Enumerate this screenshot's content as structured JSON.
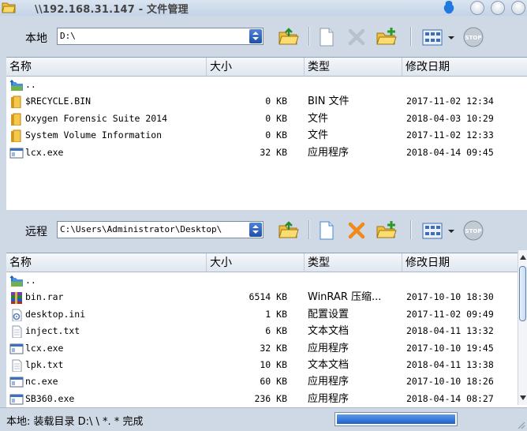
{
  "window": {
    "title": "\\\\192.168.31.147 - 文件管理"
  },
  "local": {
    "label": "本地",
    "path": "D:\\",
    "columns": [
      "名称",
      "大小",
      "类型",
      "修改日期"
    ],
    "rows": [
      {
        "icon": "parent-dir-icon",
        "name": "..",
        "size": "",
        "type": "",
        "date": ""
      },
      {
        "icon": "folder-icon",
        "name": "$RECYCLE.BIN",
        "size": "0 KB",
        "type": "BIN 文件",
        "date": "2017-11-02 12:34"
      },
      {
        "icon": "folder-icon",
        "name": "Oxygen Forensic Suite 2014",
        "size": "0 KB",
        "type": "文件",
        "date": "2018-04-03 10:29"
      },
      {
        "icon": "folder-icon",
        "name": "System Volume Information",
        "size": "0 KB",
        "type": "文件",
        "date": "2017-11-02 12:33"
      },
      {
        "icon": "exe-icon",
        "name": "lcx.exe",
        "size": "32 KB",
        "type": "应用程序",
        "date": "2018-04-14 09:45"
      }
    ]
  },
  "remote": {
    "label": "远程",
    "path": "C:\\Users\\Administrator\\Desktop\\",
    "columns": [
      "名称",
      "大小",
      "类型",
      "修改日期"
    ],
    "rows": [
      {
        "icon": "parent-dir-icon",
        "name": "..",
        "size": "",
        "type": "",
        "date": ""
      },
      {
        "icon": "rar-icon",
        "name": "bin.rar",
        "size": "6514 KB",
        "type": "WinRAR 压缩...",
        "date": "2017-10-10 18:30"
      },
      {
        "icon": "ini-icon",
        "name": "desktop.ini",
        "size": "1 KB",
        "type": "配置设置",
        "date": "2017-11-02 09:49"
      },
      {
        "icon": "txt-icon",
        "name": "inject.txt",
        "size": "6 KB",
        "type": "文本文档",
        "date": "2018-04-11 13:32"
      },
      {
        "icon": "exe-icon",
        "name": "lcx.exe",
        "size": "32 KB",
        "type": "应用程序",
        "date": "2017-10-10 19:45"
      },
      {
        "icon": "txt-icon",
        "name": "lpk.txt",
        "size": "10 KB",
        "type": "文本文档",
        "date": "2018-04-11 13:38"
      },
      {
        "icon": "exe-icon",
        "name": "nc.exe",
        "size": "60 KB",
        "type": "应用程序",
        "date": "2017-10-10 18:26"
      },
      {
        "icon": "exe-icon",
        "name": "SB360.exe",
        "size": "236 KB",
        "type": "应用程序",
        "date": "2018-04-14 08:27"
      }
    ]
  },
  "status": {
    "text": "本地: 装载目录 D:\\ \\ *. * 完成",
    "progress": 1.0
  },
  "colors": {
    "accent": "#1e62c9",
    "folder": "#e8b830",
    "delete": "#f08a1c"
  }
}
